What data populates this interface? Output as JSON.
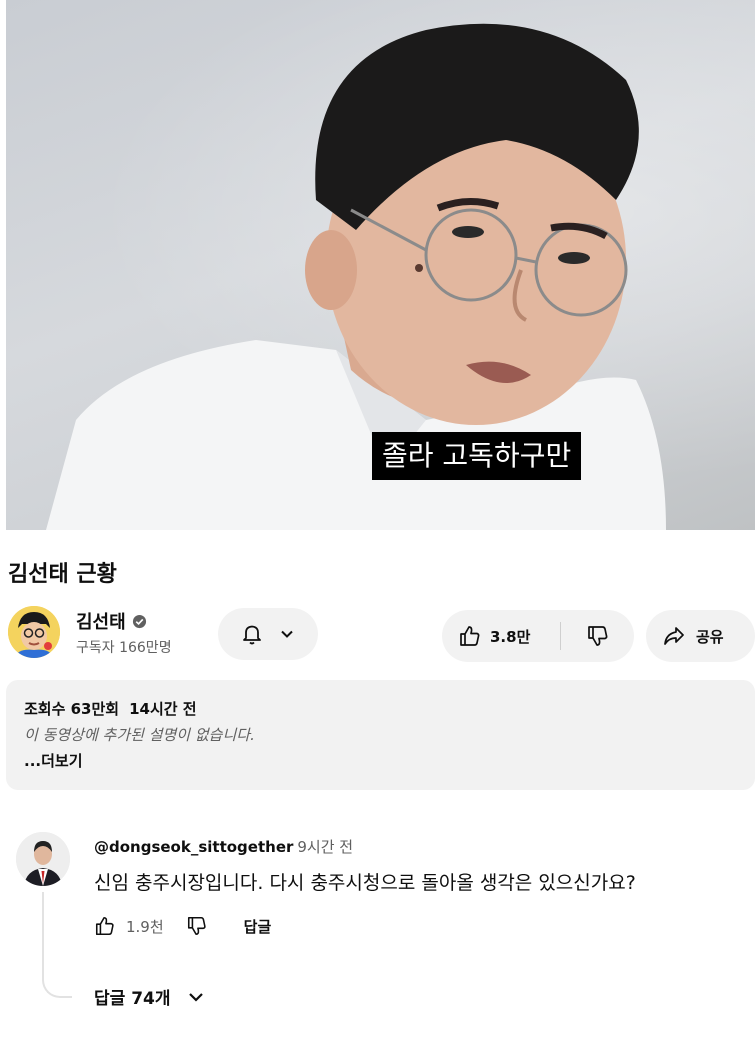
{
  "video": {
    "subtitle": "졸라 고독하구만"
  },
  "title": "김선태 근황",
  "channel": {
    "name": "김선태",
    "subscribers": "구독자 166만명",
    "verified": true
  },
  "actions": {
    "like_count": "3.8만",
    "share_label": "공유"
  },
  "description": {
    "views": "조회수 63만회",
    "time": "14시간 전",
    "text": "이 동영상에 추가된 설명이 없습니다.",
    "more": "...더보기"
  },
  "comment": {
    "user": "@dongseok_sittogether",
    "time": "9시간 전",
    "text": "신임 충주시장입니다. 다시 충주시청으로 돌아올 생각은 있으신가요?",
    "like_count": "1.9천",
    "reply_label": "답글",
    "replies_label": "답글 74개"
  },
  "icons": {
    "bell": "bell-icon",
    "chevron": "chevron-down-icon",
    "like": "thumbs-up-icon",
    "dislike": "thumbs-down-icon",
    "share": "share-arrow-icon",
    "verified": "verified-check-icon"
  },
  "colors": {
    "pill_bg": "#f2f2f2",
    "text_secondary": "#606060",
    "subtitle_bg": "#000000"
  }
}
